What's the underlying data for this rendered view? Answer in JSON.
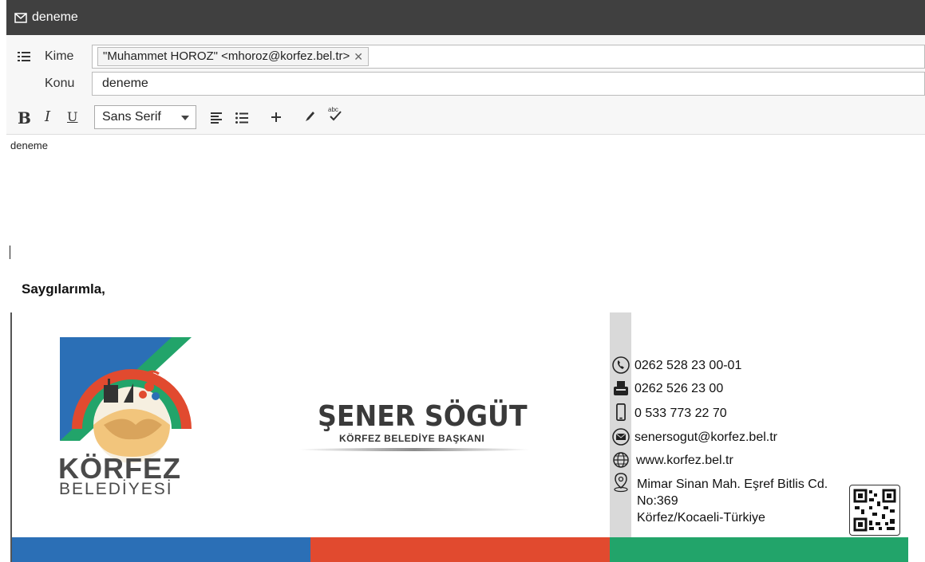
{
  "window": {
    "title": "deneme"
  },
  "compose": {
    "to_label": "Kime",
    "to_recipient": "\"Muhammet HOROZ\" <mhoroz@korfez.bel.tr>",
    "subject_label": "Konu",
    "subject_value": "deneme"
  },
  "toolbar": {
    "bold": "B",
    "italic": "I",
    "underline": "U",
    "font_family": "Sans Serif",
    "spellcheck_label": "abc"
  },
  "body": {
    "text": "deneme",
    "closing": "Saygılarımla,"
  },
  "signature": {
    "org_name": "KÖRFEZ",
    "org_sub": "BELEDİYESİ",
    "person_name": "ŞENER SÖGÜT",
    "person_title": "KÖRFEZ BELEDİYE BAŞKANI",
    "phone": "0262 528 23 00-01",
    "fax": "0262 526 23 00",
    "mobile": "0 533 773 22 70",
    "email": "senersogut@korfez.bel.tr",
    "website": "www.korfez.bel.tr",
    "address_line1": "Mimar Sinan Mah. Eşref Bitlis Cd.",
    "address_line2": "No:369",
    "address_line3": "Körfez/Kocaeli-Türkiye",
    "colors": {
      "blue": "#2b6fb6",
      "red": "#e14a2f",
      "green": "#22a46a"
    }
  },
  "icons": [
    "mail-icon",
    "list-icon",
    "align-icon",
    "bullet-list-icon",
    "plus-icon",
    "pen-icon",
    "spellcheck-icon",
    "phone-icon",
    "fax-icon",
    "mobile-icon",
    "email-icon",
    "globe-icon",
    "location-icon",
    "qr-code"
  ]
}
